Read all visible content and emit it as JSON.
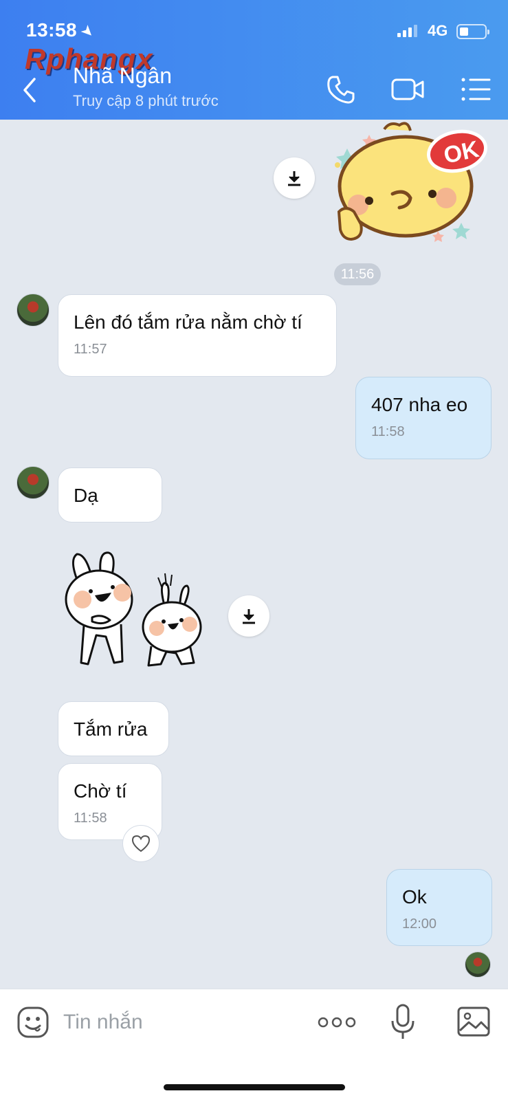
{
  "status_bar": {
    "time": "13:58",
    "network": "4G"
  },
  "watermark": "Rphangx",
  "header": {
    "name": "Nhã Ngân",
    "last_seen": "Truy cập 8 phút trước",
    "icons": [
      "back-icon",
      "phone-icon",
      "video-camera-icon",
      "list-menu-icon"
    ]
  },
  "messages": [
    {
      "type": "sticker",
      "from": "me",
      "sticker_text": "OK"
    },
    {
      "type": "time-separator",
      "text": "11:56"
    },
    {
      "type": "text",
      "from": "them",
      "text": "Lên đó tắm rửa nằm chờ tí",
      "time": "11:57"
    },
    {
      "type": "text",
      "from": "me",
      "text": "407 nha eo",
      "time": "11:58"
    },
    {
      "type": "text",
      "from": "them",
      "text": "Dạ"
    },
    {
      "type": "sticker",
      "from": "them"
    },
    {
      "type": "text",
      "from": "them",
      "text": "Tắm rửa"
    },
    {
      "type": "text",
      "from": "them",
      "text": "Chờ tí",
      "time": "11:58"
    },
    {
      "type": "text",
      "from": "me",
      "text": "Ok",
      "time": "12:00"
    }
  ],
  "input": {
    "placeholder": "Tin nhắn"
  },
  "colors": {
    "header_gradient_start": "#3d7ff0",
    "header_gradient_end": "#4a9bef",
    "chat_bg": "#e3e8ef",
    "out_bubble": "#d6ebfb",
    "in_bubble": "#ffffff"
  }
}
